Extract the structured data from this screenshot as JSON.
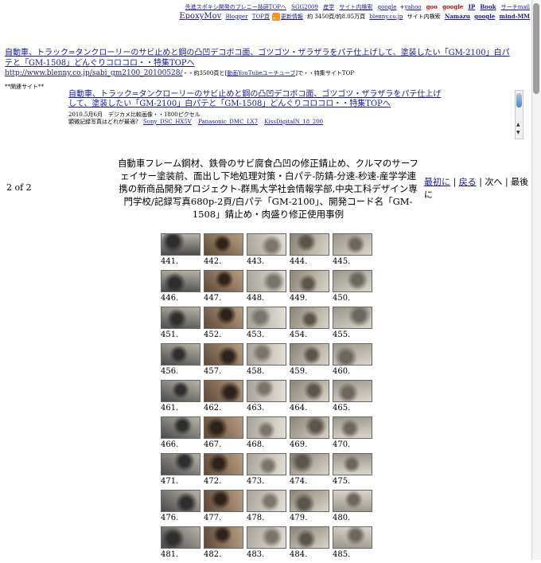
{
  "topnav": {
    "row1": [
      "先進スポキシ開発のブレニー技研TOPへ",
      "SGG2009",
      "産学",
      "サイト内検索",
      "google",
      "yahoo",
      "goo",
      "google",
      "IP",
      "Book",
      "サーチmail"
    ],
    "row2_epoxy": "EpoxyMov",
    "row2": [
      "Blogger",
      "TOP頁",
      "更新情報",
      "約 3450頁/約8.05万頁",
      "blenny.co.jp",
      "サイト内検索",
      "Namazu",
      "google",
      "mind-MM"
    ]
  },
  "headline": {
    "title": "自動車、トラック=タンクローリーのサビ止めと鋼の凸凹デコボコ面、ゴツゴツ・ザラザラをパテ仕上げして、塗装したい「GM-2100」白パテと「GM-1508」どんぐりコロコロ・・特集TOPへ",
    "url": "http://www.blenny.co.jp/sabi_gm2100_20100528/",
    "after_url": "・・約3500頁と",
    "video_link": "動画YouTubeユーチューブ",
    "after_video": "で・・特集サイトTOP"
  },
  "related_label": "**関連サイト**",
  "frame": {
    "title": "自動車、トラック=タンクローリーのサビ止めと鋼の凸凹デコボコ面、ゴツゴツ・ザラザラをパテ仕上げして、塗装したい「GM-2100」白パテと「GM-1508」どんぐりコロコロ・・特集TOPへ",
    "meta1": "2010.5月6月　デジカメ比較画像・・1800ピクセル",
    "meta2_label": "顕微記録写真はどれが最適?",
    "cams": [
      "Sony_DSC_HX5V",
      "Panasonic_DMC_LX7",
      "KissDigitalN_18_200"
    ]
  },
  "pagination": {
    "label": "2 of 2"
  },
  "main_title": "自動車フレーム鋼材、鉄骨のサビ腐食凸凹の修正錆止め、クルマのサーフェイサー塗装前、面出し下地処理対策・白パテ-防錆-分速-秒速-産学学連携の新商品開発プロジェクト-群馬大学社会情報学部,中央工科デザイン専門学校/記録写真680p-2頁/白パテ「GM-2100」、開発コード名「GM-1508」錆止め・肉盛り修正使用事例",
  "nav": {
    "first": "最初に",
    "back": "戻る",
    "next": "次へ",
    "last": "最後に",
    "sep": "|"
  },
  "thumbnails": [
    "441.",
    "442.",
    "443.",
    "444.",
    "445.",
    "446.",
    "447.",
    "448.",
    "449.",
    "450.",
    "451.",
    "452.",
    "453.",
    "454.",
    "455.",
    "456.",
    "457.",
    "458.",
    "459.",
    "460.",
    "461.",
    "462.",
    "463.",
    "464.",
    "465.",
    "466.",
    "467.",
    "468.",
    "469.",
    "470.",
    "471.",
    "472.",
    "473.",
    "474.",
    "475.",
    "476.",
    "477.",
    "478.",
    "479.",
    "480.",
    "481.",
    "482.",
    "483.",
    "484.",
    "485."
  ]
}
